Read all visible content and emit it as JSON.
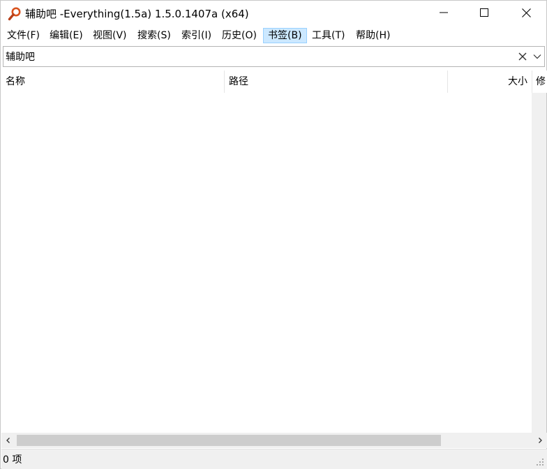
{
  "window": {
    "title": "辅助吧 -Everything(1.5a) 1.5.0.1407a (x64)",
    "icon": "magnifier-icon",
    "controls": [
      "minimize-icon",
      "maximize-icon",
      "close-icon"
    ]
  },
  "menu": {
    "items": [
      {
        "label": "文件(F)"
      },
      {
        "label": "编辑(E)"
      },
      {
        "label": "视图(V)"
      },
      {
        "label": "搜索(S)"
      },
      {
        "label": "索引(I)"
      },
      {
        "label": "历史(O)"
      },
      {
        "label": "书签(B)"
      },
      {
        "label": "工具(T)"
      },
      {
        "label": "帮助(H)"
      }
    ],
    "active_item": "书签(B)"
  },
  "search": {
    "value": "辅助吧",
    "placeholder": ""
  },
  "columns": [
    {
      "label": "名称"
    },
    {
      "label": "路径"
    },
    {
      "label": "大小"
    },
    {
      "label": "修"
    }
  ],
  "results": [],
  "status": {
    "count_text": "0 项"
  },
  "colors": {
    "menu_active_bg": "#cce8ff",
    "icon_orange": "#d9531e",
    "scrollbar_thumb": "#cdcdcd"
  }
}
